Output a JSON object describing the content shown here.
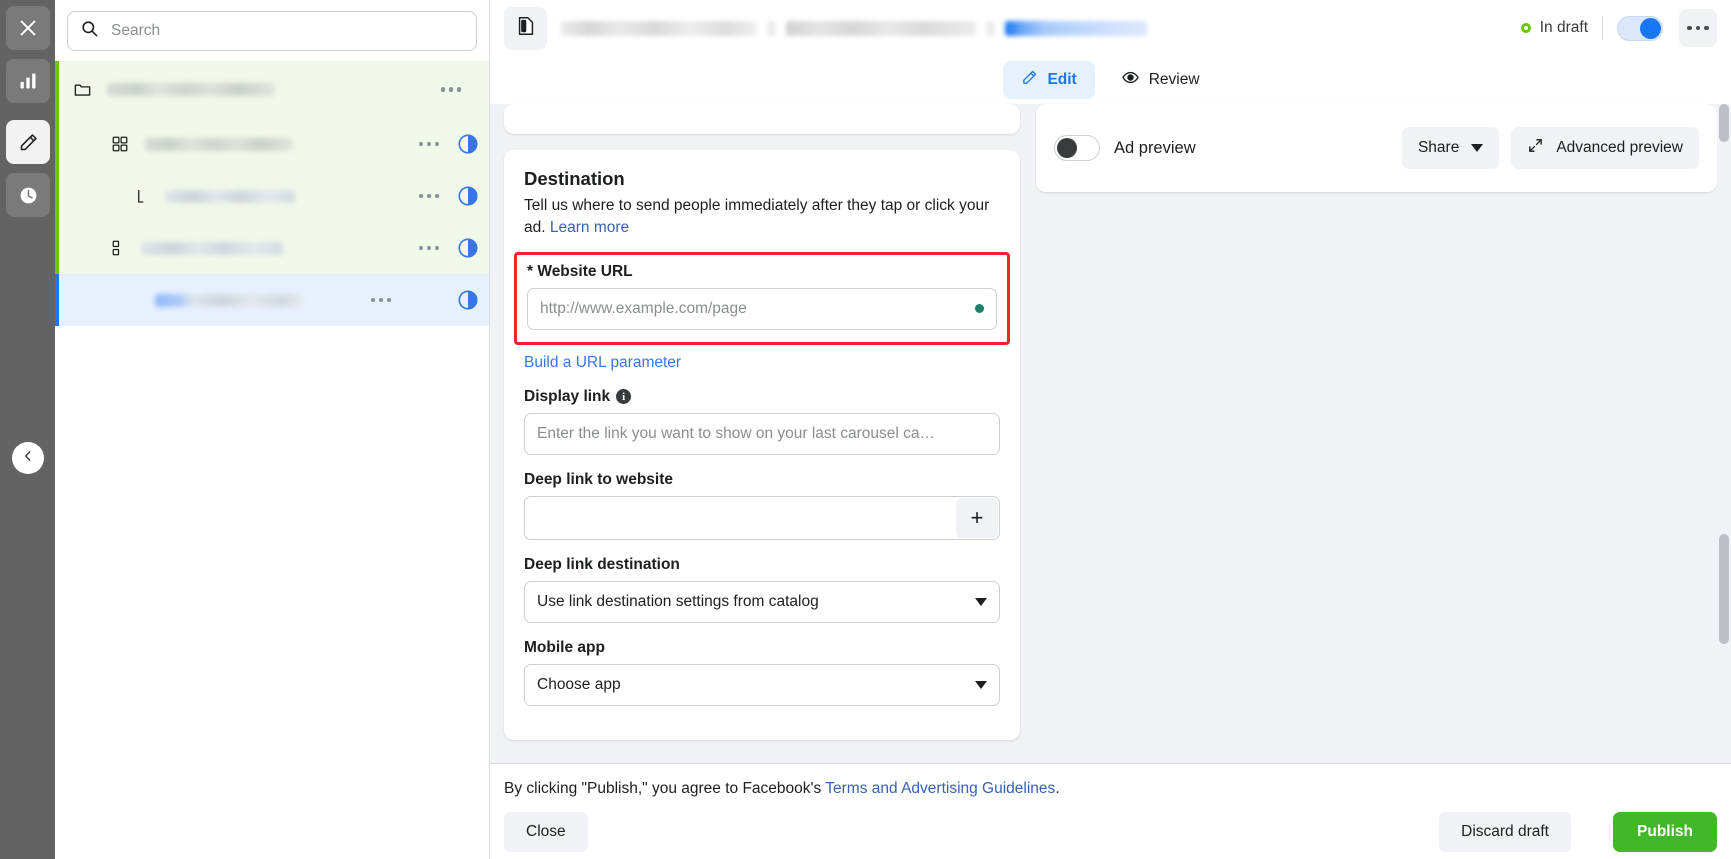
{
  "rail": {
    "items": [
      {
        "name": "close-icon",
        "label": "Close"
      },
      {
        "name": "analytics-icon",
        "label": "Analytics"
      },
      {
        "name": "edit-icon",
        "label": "Edit"
      },
      {
        "name": "history-icon",
        "label": "History"
      }
    ],
    "collapse_label": "Collapse"
  },
  "sidebar": {
    "search": {
      "placeholder": "Search",
      "value": ""
    },
    "rows": [
      {
        "icon": "folder-icon",
        "redacted": true,
        "state": "green",
        "has_menu": true,
        "has_toggle": false,
        "indent": 0
      },
      {
        "icon": "campaign-grid-icon",
        "redacted": true,
        "state": "green",
        "has_menu": true,
        "has_toggle": true,
        "indent": 1
      },
      {
        "icon": "adset-icon",
        "redacted": true,
        "state": "green",
        "has_menu": true,
        "has_toggle": true,
        "indent": 2
      },
      {
        "icon": "ads-grid-icon",
        "redacted": true,
        "state": "green",
        "has_menu": true,
        "has_toggle": true,
        "indent": 1
      },
      {
        "icon": "ad-icon",
        "redacted": true,
        "state": "blue",
        "has_menu": true,
        "has_toggle": true,
        "indent": 2
      }
    ]
  },
  "header": {
    "thumb_icon": "ad-thumbnail-icon",
    "breadcrumbs": [
      "",
      "",
      ""
    ],
    "status": "In draft",
    "status_color": "#6ec60a",
    "toggle_on": true,
    "accent": "#1877f2",
    "more_label": "More options"
  },
  "tabs": [
    {
      "label": "Edit",
      "icon": "pencil-icon",
      "selected": true
    },
    {
      "label": "Review",
      "icon": "eye-icon",
      "selected": false
    }
  ],
  "destination": {
    "title": "Destination",
    "description": "Tell us where to send people immediately after they tap or click your ad.",
    "learn_more": "Learn more",
    "website_url": {
      "label": "* Website URL",
      "placeholder": "http://www.example.com/page",
      "value": "",
      "highlight_color": "#f5222d",
      "status_dot_color": "#1a7f6b"
    },
    "build_url_parameter": "Build a URL parameter",
    "display_link": {
      "label": "Display link",
      "info_icon": "info-icon",
      "placeholder": "Enter the link you want to show on your last carousel ca…",
      "value": ""
    },
    "deep_link_website": {
      "label": "Deep link to website",
      "value": "",
      "add_label": "+"
    },
    "deep_link_destination": {
      "label": "Deep link destination",
      "value": "Use link destination settings from catalog"
    },
    "mobile_app": {
      "label": "Mobile app",
      "value": "Choose app"
    }
  },
  "preview": {
    "toggle_label": "Ad preview",
    "toggle_on": false,
    "share_label": "Share",
    "advanced_label": "Advanced preview"
  },
  "footer": {
    "legal_prefix": "By clicking \"Publish,\" you agree to Facebook's ",
    "legal_link": "Terms and Advertising Guidelines",
    "legal_suffix": ".",
    "close_label": "Close",
    "discard_label": "Discard draft",
    "publish_label": "Publish",
    "publish_color": "#42b72a"
  }
}
